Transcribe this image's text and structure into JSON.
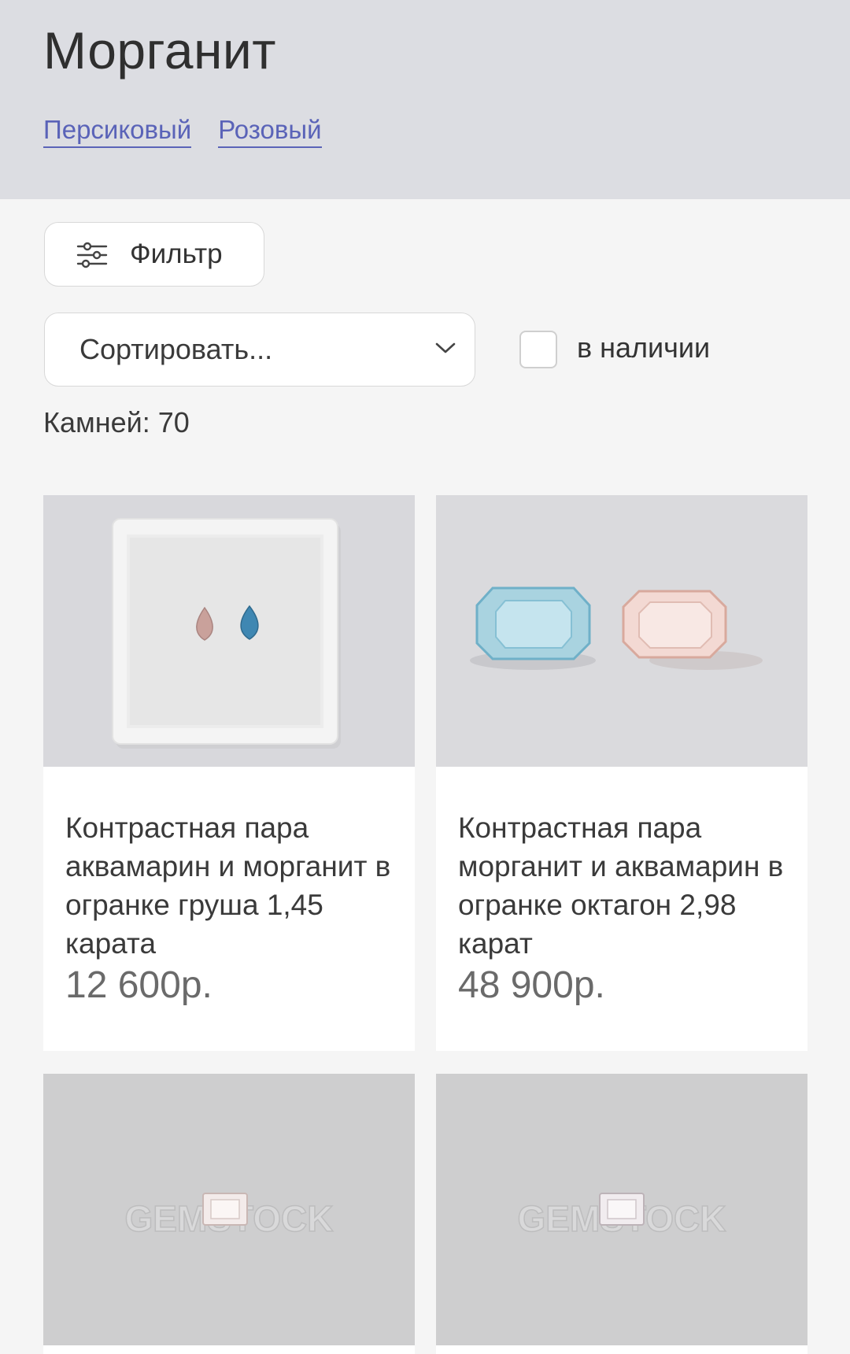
{
  "header": {
    "title": "Морганит",
    "tags": [
      "Персиковый",
      "Розовый"
    ]
  },
  "filter": {
    "label": "Фильтр",
    "icon": "sliders-icon"
  },
  "sort": {
    "placeholder": "Сортировать...",
    "icon": "chevron-down-icon"
  },
  "in_stock": {
    "label": "в наличии",
    "checked": false
  },
  "count": {
    "text": "Камней: 70"
  },
  "products": [
    {
      "title": "Контрастная пара аквамарин и морганит в огранке груша 1,45 карата",
      "price": "12 600р."
    },
    {
      "title": "Контрастная пара морганит и аквамарин в огранке октагон 2,98 карат",
      "price": "48 900р."
    },
    {
      "title": "",
      "price": ""
    },
    {
      "title": "",
      "price": ""
    }
  ],
  "watermark": "GEMSTOCK",
  "colors": {
    "header_bg": "#dcdde2",
    "link": "#5a63b8",
    "page_bg": "#f5f5f5"
  }
}
